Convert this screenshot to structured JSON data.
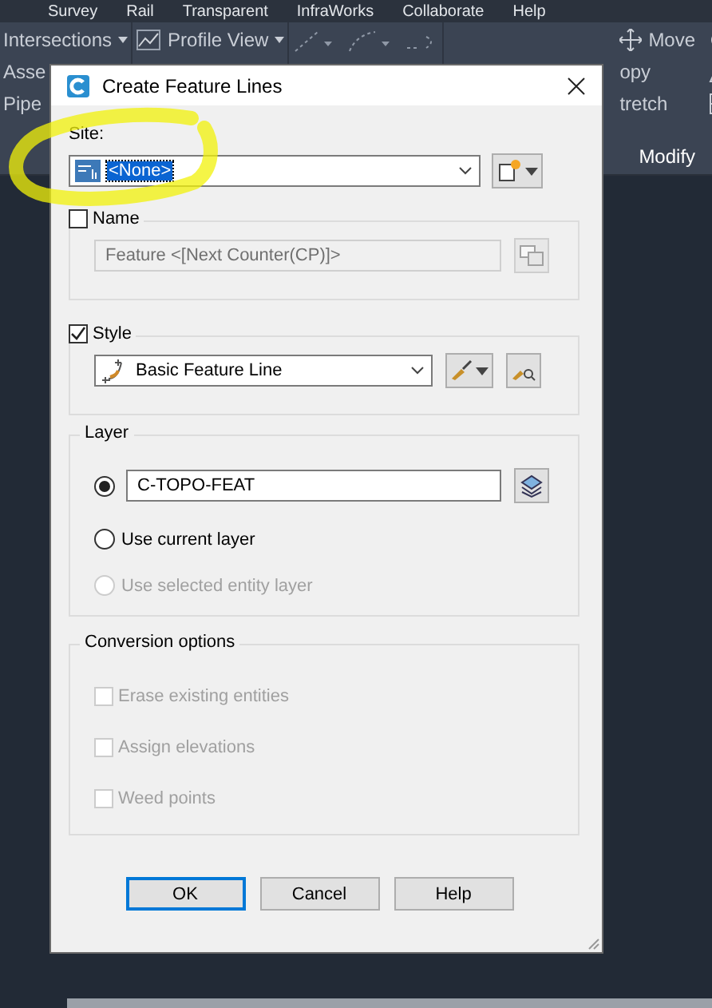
{
  "menu_bar": [
    "Survey",
    "Rail",
    "Transparent",
    "InfraWorks",
    "Collaborate",
    "Help"
  ],
  "ribbon": {
    "left_column": [
      "Intersections",
      "Asse",
      "Pipe"
    ],
    "profile_view": "Profile View",
    "right_column": [
      "Move",
      "opy",
      "tretch"
    ],
    "panel_title": "Modify"
  },
  "dialog": {
    "title": "Create Feature Lines",
    "site": {
      "label": "Site:",
      "value": "<None>"
    },
    "name": {
      "label": "Name",
      "checked": false,
      "value": "Feature <[Next Counter(CP)]>",
      "disabled": true
    },
    "style": {
      "label": "Style",
      "checked": true,
      "value": "Basic Feature Line"
    },
    "layer": {
      "title": "Layer",
      "options": [
        {
          "kind": "field",
          "value": "C-TOPO-FEAT",
          "selected": true,
          "disabled": false
        },
        {
          "kind": "label",
          "label": "Use current layer",
          "selected": false,
          "disabled": false
        },
        {
          "kind": "label",
          "label": "Use selected entity layer",
          "selected": false,
          "disabled": true
        }
      ]
    },
    "conversion": {
      "title": "Conversion options",
      "options": [
        {
          "label": "Erase existing entities",
          "checked": false,
          "disabled": true
        },
        {
          "label": "Assign elevations",
          "checked": false,
          "disabled": true
        },
        {
          "label": "Weed points",
          "checked": false,
          "disabled": true
        }
      ]
    },
    "buttons": [
      {
        "label": "OK",
        "default": true
      },
      {
        "label": "Cancel",
        "default": false
      },
      {
        "label": "Help",
        "default": false
      }
    ]
  }
}
